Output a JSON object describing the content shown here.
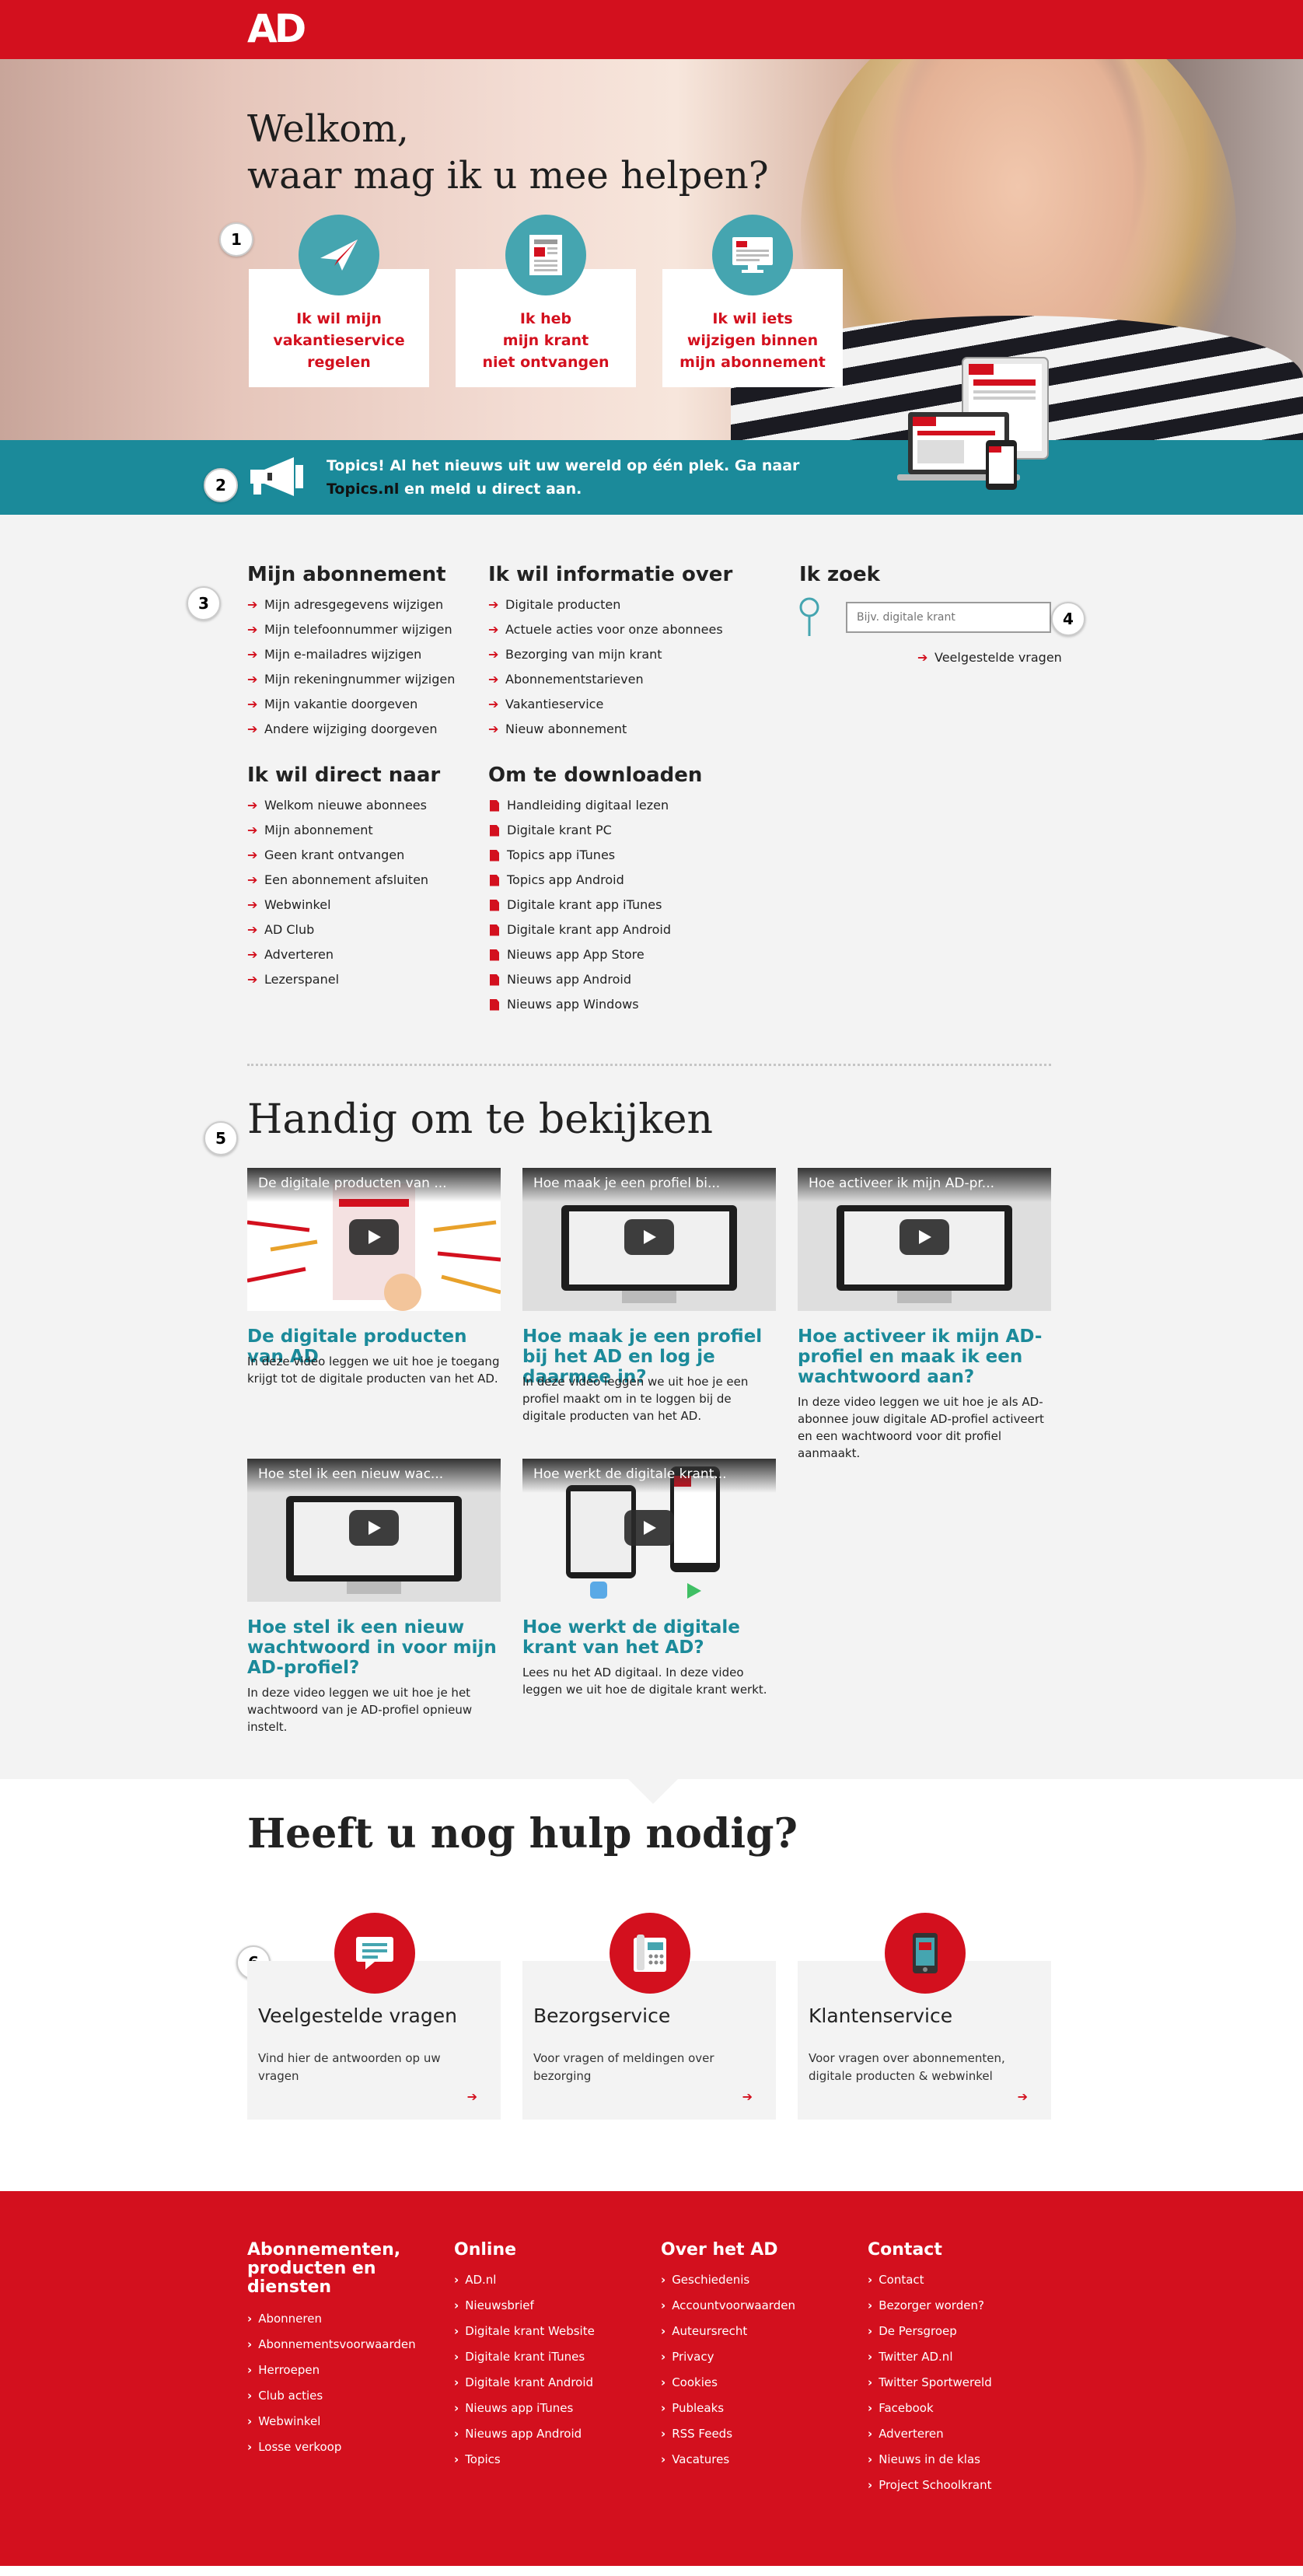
{
  "header": {
    "logo_text": "AD",
    "brand_color": "#d3101e"
  },
  "hero": {
    "title_line1": "Welkom,",
    "title_line2": "waar mag ik u mee helpen?",
    "tiles": [
      {
        "icon": "paper-plane-icon",
        "line1": "Ik wil mijn",
        "line2": "vakantieservice",
        "line3": "regelen"
      },
      {
        "icon": "newspaper-icon",
        "line1": "Ik heb",
        "line2": "mijn krant",
        "line3": "niet ontvangen"
      },
      {
        "icon": "monitor-icon",
        "line1": "Ik wil iets",
        "line2": "wijzigen binnen",
        "line3": "mijn abonnement"
      }
    ]
  },
  "markers": [
    "1",
    "2",
    "3",
    "4",
    "5",
    "6"
  ],
  "banner": {
    "text_before": "Topics! Al het nieuws uit uw wereld op één plek. Ga naar ",
    "link": "Topics.nl",
    "text_after": " en meld u direct aan.",
    "color": "#1b8a9a"
  },
  "links": {
    "abonnement": {
      "heading": "Mijn abonnement",
      "items": [
        "Mijn adresgegevens wijzigen",
        "Mijn telefoonnummer wijzigen",
        "Mijn e-mailadres wijzigen",
        "Mijn rekeningnummer wijzigen",
        "Mijn vakantie doorgeven",
        "Andere wijziging doorgeven"
      ]
    },
    "informatie": {
      "heading": "Ik wil informatie over",
      "items": [
        "Digitale producten",
        "Actuele acties voor onze abonnees",
        "Bezorging van mijn krant",
        "Abonnementstarieven",
        "Vakantieservice",
        "Nieuw abonnement"
      ]
    },
    "direct": {
      "heading": "Ik wil direct naar",
      "items": [
        "Welkom nieuwe abonnees",
        "Mijn abonnement",
        "Geen krant ontvangen",
        "Een abonnement afsluiten",
        "Webwinkel",
        "AD Club",
        "Adverteren",
        "Lezerspanel"
      ]
    },
    "downloaden": {
      "heading": "Om te downloaden",
      "items": [
        "Handleiding digitaal lezen",
        "Digitale krant PC",
        "Topics app iTunes",
        "Topics app Android",
        "Digitale krant app iTunes",
        "Digitale krant app Android",
        "Nieuws app App Store",
        "Nieuws app Android",
        "Nieuws app Windows"
      ]
    }
  },
  "search": {
    "heading": "Ik zoek",
    "placeholder": "Bijv. digitale krant",
    "faq_link": "Veelgestelde vragen"
  },
  "videos": {
    "heading": "Handig om te bekijken",
    "items": [
      {
        "bar": "De digitale producten van ...",
        "title": "De digitale producten van AD",
        "desc": "In deze video leggen we uit hoe je toegang krijgt tot de digitale producten van het AD."
      },
      {
        "bar": "Hoe maak je een profiel bi...",
        "title": "Hoe maak je een profiel bij het AD en log je daarmee in?",
        "desc": "In deze video leggen we uit hoe je een profiel maakt om in te loggen bij de digitale producten van het AD."
      },
      {
        "bar": "Hoe activeer ik mijn AD-pr...",
        "title": "Hoe activeer ik mijn AD-profiel en maak ik een wachtwoord aan?",
        "desc": "In deze video leggen we uit hoe je als AD-abonnee jouw digitale AD-profiel activeert en een wachtwoord voor dit profiel aanmaakt."
      },
      {
        "bar": "Hoe stel ik een nieuw wac...",
        "title": "Hoe stel ik een nieuw wachtwoord in voor mijn AD-profiel?",
        "desc": "In deze video leggen we uit hoe je het wachtwoord van je AD-profiel opnieuw instelt."
      },
      {
        "bar": "Hoe werkt de digitale krant...",
        "title": "Hoe werkt de digitale krant van het AD?",
        "desc": "Lees nu het AD digitaal. In deze video leggen we uit hoe de digitale krant werkt."
      }
    ]
  },
  "help": {
    "heading": "Heeft u nog hulp nodig?",
    "cards": [
      {
        "icon": "chat-bubble-icon",
        "title": "Veelgestelde vragen",
        "desc": "Vind hier de antwoorden op uw vragen"
      },
      {
        "icon": "phone-icon",
        "title": "Bezorgservice",
        "desc": "Voor vragen of meldingen over bezorging"
      },
      {
        "icon": "mobile-phone-icon",
        "title": "Klantenservice",
        "desc": "Voor vragen over abonnementen, digitale producten & webwinkel"
      }
    ]
  },
  "footer": {
    "cols": [
      {
        "heading": "Abonnementen, producten en diensten",
        "items": [
          "Abonneren",
          "Abonnementsvoorwaarden",
          "Herroepen",
          "Club acties",
          "Webwinkel",
          "Losse verkoop"
        ]
      },
      {
        "heading": "Online",
        "items": [
          "AD.nl",
          "Nieuwsbrief",
          "Digitale krant Website",
          "Digitale krant iTunes",
          "Digitale krant Android",
          "Nieuws app iTunes",
          "Nieuws app Android",
          "Topics"
        ]
      },
      {
        "heading": "Over het AD",
        "items": [
          "Geschiedenis",
          "Accountvoorwaarden",
          "Auteursrecht",
          "Privacy",
          "Cookies",
          "Publeaks",
          "RSS Feeds",
          "Vacatures"
        ]
      },
      {
        "heading": "Contact",
        "items": [
          "Contact",
          "Bezorger worden?",
          "De Persgroep",
          "Twitter AD.nl",
          "Twitter Sportwereld",
          "Facebook",
          "Adverteren",
          "Nieuws in de klas",
          "Project Schoolkrant"
        ]
      }
    ]
  }
}
